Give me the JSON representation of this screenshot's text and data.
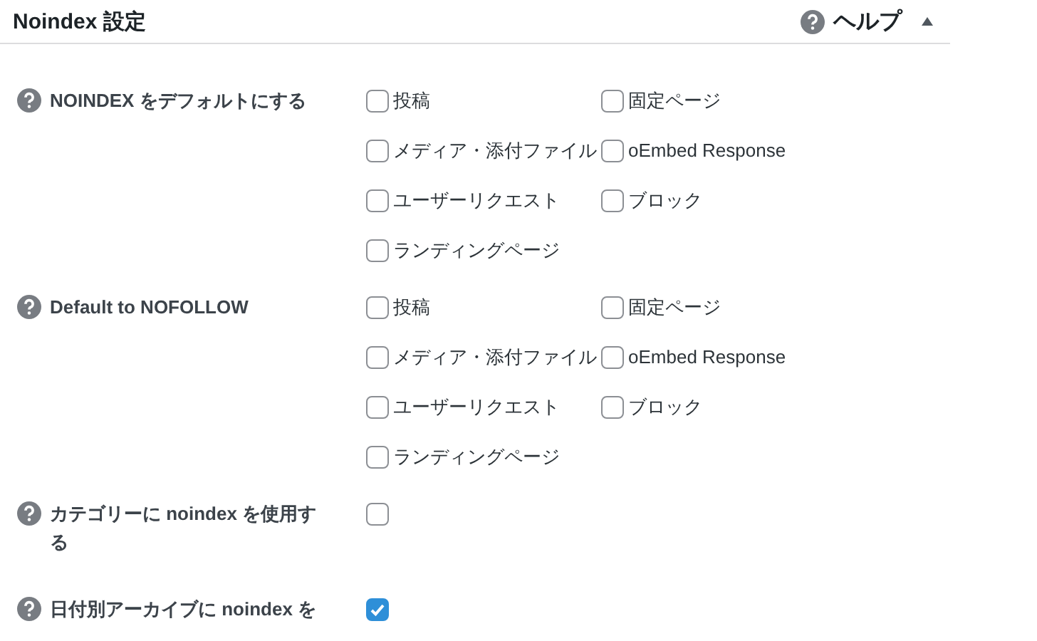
{
  "panel": {
    "title": "Noindex 設定",
    "help_label": "ヘルプ",
    "expanded": true
  },
  "rows": [
    {
      "kind": "group",
      "label": "NOINDEX をデフォルトにする",
      "options": [
        {
          "label": "投稿",
          "checked": false
        },
        {
          "label": "固定ページ",
          "checked": false
        },
        {
          "label": "メディア・添付ファイル",
          "checked": false
        },
        {
          "label": "oEmbed Response",
          "checked": false
        },
        {
          "label": "ユーザーリクエスト",
          "checked": false
        },
        {
          "label": "ブロック",
          "checked": false
        },
        {
          "label": "ランディングページ",
          "checked": false
        }
      ]
    },
    {
      "kind": "group",
      "label": "Default to NOFOLLOW",
      "options": [
        {
          "label": "投稿",
          "checked": false
        },
        {
          "label": "固定ページ",
          "checked": false
        },
        {
          "label": "メディア・添付ファイル",
          "checked": false
        },
        {
          "label": "oEmbed Response",
          "checked": false
        },
        {
          "label": "ユーザーリクエスト",
          "checked": false
        },
        {
          "label": "ブロック",
          "checked": false
        },
        {
          "label": "ランディングページ",
          "checked": false
        }
      ]
    },
    {
      "kind": "single",
      "label": "カテゴリーに noindex を使用する",
      "checked": false
    },
    {
      "kind": "single",
      "label": "日付別アーカイブに noindex を",
      "checked": true
    }
  ]
}
